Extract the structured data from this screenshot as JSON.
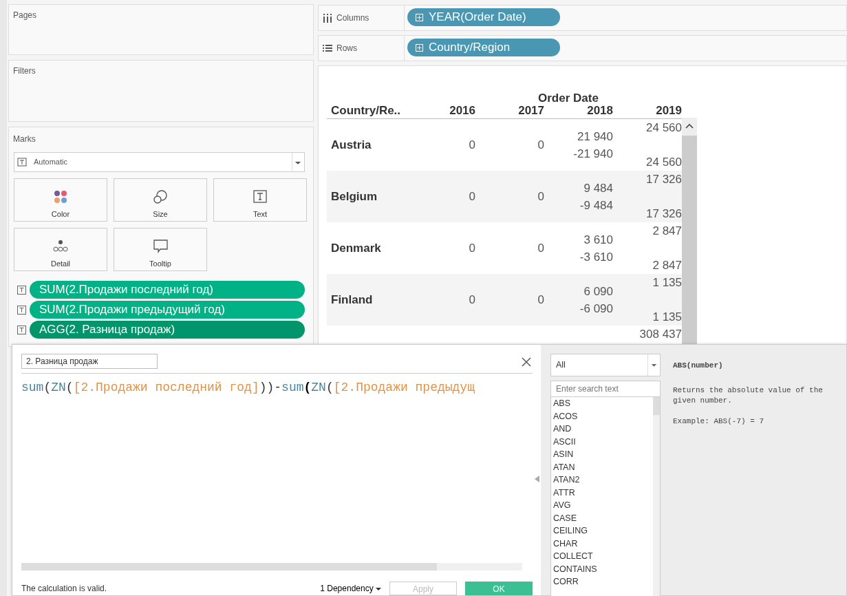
{
  "shelves": {
    "pages": {
      "title": "Pages"
    },
    "filters": {
      "title": "Filters"
    },
    "columns": {
      "label": "Columns",
      "pill": "YEAR(Order Date)"
    },
    "rows": {
      "label": "Rows",
      "pill": "Country/Region"
    }
  },
  "marks": {
    "title": "Marks",
    "mark_type": "Automatic",
    "cards": [
      {
        "label": "Color",
        "kind": "color"
      },
      {
        "label": "Size",
        "kind": "size"
      },
      {
        "label": "Text",
        "kind": "text"
      },
      {
        "label": "Detail",
        "kind": "detail"
      },
      {
        "label": "Tooltip",
        "kind": "tooltip"
      }
    ],
    "fields": [
      {
        "label": "SUM(2.Продажи последний год)",
        "kind": "sum"
      },
      {
        "label": "SUM(2.Продажи предыдущий год)",
        "kind": "sum"
      },
      {
        "label": "AGG(2. Разница продаж)",
        "kind": "agg"
      }
    ]
  },
  "table": {
    "group_header": "Order Date",
    "columns": [
      "Country/Re..",
      "2016",
      "2017",
      "2018",
      "2019"
    ],
    "rows": [
      {
        "cells": [
          "Austria",
          [
            "0"
          ],
          [
            "0"
          ],
          [
            "21 940",
            "-21 940"
          ],
          [
            "24 560",
            null,
            "24 560"
          ]
        ]
      },
      {
        "cells": [
          "Belgium",
          [
            "0"
          ],
          [
            "0"
          ],
          [
            "9 484",
            "-9 484"
          ],
          [
            "17 326",
            null,
            "17 326"
          ]
        ]
      },
      {
        "cells": [
          "Denmark",
          [
            "0"
          ],
          [
            "0"
          ],
          [
            "3 610",
            "-3 610"
          ],
          [
            "2 847",
            null,
            "2 847"
          ]
        ]
      },
      {
        "cells": [
          "Finland",
          [
            "0"
          ],
          [
            "0"
          ],
          [
            "6 090",
            "-6 090"
          ],
          [
            "1 135",
            null,
            "1 135"
          ]
        ]
      },
      {
        "cells": [
          null,
          null,
          null,
          null,
          [
            "308 437"
          ]
        ]
      }
    ]
  },
  "calc_dialog": {
    "name": "2. Разница продаж",
    "formula": [
      {
        "text": "sum",
        "kind": "func"
      },
      {
        "text": "(",
        "kind": "punct"
      },
      {
        "text": "ZN",
        "kind": "func"
      },
      {
        "text": "(",
        "kind": "punct"
      },
      {
        "text": "[2.Продажи последний год]",
        "kind": "field"
      },
      {
        "text": "))-",
        "kind": "punct"
      },
      {
        "text": "sum",
        "kind": "func"
      },
      {
        "text": "(",
        "kind": "bold"
      },
      {
        "text": "ZN",
        "kind": "func"
      },
      {
        "text": "(",
        "kind": "punct"
      },
      {
        "text": "[2.Продажи предыдущ",
        "kind": "field"
      }
    ],
    "status": "The calculation is valid.",
    "dependency": "1 Dependency",
    "buttons": [
      {
        "label": "Apply",
        "disabled": true,
        "primary": false
      },
      {
        "label": "OK",
        "disabled": false,
        "primary": true
      }
    ],
    "category": "All",
    "search": {
      "placeholder": "Enter search text"
    },
    "functions": [
      "ABS",
      "ACOS",
      "AND",
      "ASCII",
      "ASIN",
      "ATAN",
      "ATAN2",
      "ATTR",
      "AVG",
      "CASE",
      "CEILING",
      "CHAR",
      "COLLECT",
      "CONTAINS",
      "CORR"
    ],
    "help": {
      "signature": "ABS(number)",
      "description": "Returns the absolute value of the given number.",
      "example": "Example: ABS(-7) = 7"
    }
  }
}
